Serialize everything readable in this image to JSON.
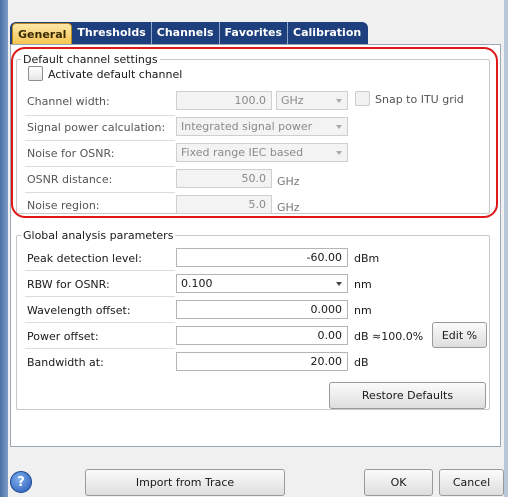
{
  "tabs": [
    {
      "label": "General"
    },
    {
      "label": "Thresholds"
    },
    {
      "label": "Channels"
    },
    {
      "label": "Favorites"
    },
    {
      "label": "Calibration"
    }
  ],
  "default_channel": {
    "group_title": "Default channel settings",
    "activate_label": "Activate default channel",
    "channel_width_label": "Channel width:",
    "channel_width_value": "100.0",
    "channel_width_unit": "GHz",
    "snap_label": "Snap to ITU grid",
    "signal_power_label": "Signal power calculation:",
    "signal_power_value": "Integrated signal power",
    "noise_osnr_label": "Noise for OSNR:",
    "noise_osnr_value": "Fixed range IEC based",
    "osnr_distance_label": "OSNR distance:",
    "osnr_distance_value": "50.0",
    "osnr_distance_unit": "GHz",
    "noise_region_label": "Noise region:",
    "noise_region_value": "5.0",
    "noise_region_unit": "GHz"
  },
  "global": {
    "group_title": "Global analysis parameters",
    "peak_label": "Peak detection level:",
    "peak_value": "-60.00",
    "peak_unit": "dBm",
    "rbw_label": "RBW for OSNR:",
    "rbw_value": "0.100",
    "rbw_unit": "nm",
    "wl_offset_label": "Wavelength offset:",
    "wl_offset_value": "0.000",
    "wl_offset_unit": "nm",
    "power_offset_label": "Power offset:",
    "power_offset_value": "0.00",
    "power_offset_unit": "dB ≈100.0%",
    "edit_percent_label": "Edit %",
    "bandwidth_label": "Bandwidth at:",
    "bandwidth_value": "20.00",
    "bandwidth_unit": "dB",
    "restore_label": "Restore Defaults"
  },
  "footer": {
    "help_glyph": "?",
    "import_label": "Import from Trace",
    "ok_label": "OK",
    "cancel_label": "Cancel"
  },
  "colors": {
    "tab_bar": "#1d3f7e",
    "active_tab": "#f6c453",
    "highlight": "#e01818"
  },
  "icons": [
    "help-icon",
    "dropdown-arrow-icon"
  ]
}
